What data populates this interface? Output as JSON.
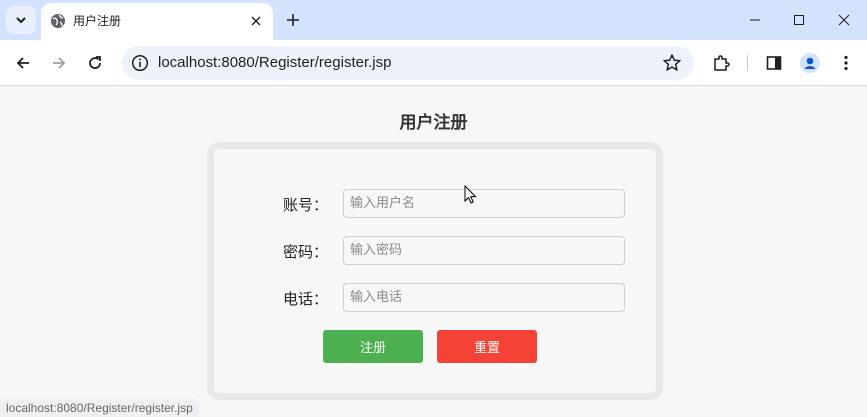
{
  "browser": {
    "tab_title": "用户注册",
    "url": "localhost:8080/Register/register.jsp",
    "status_url": "localhost:8080/Register/register.jsp"
  },
  "page": {
    "title": "用户注册",
    "fields": [
      {
        "label": "账号：",
        "placeholder": "输入用户名"
      },
      {
        "label": "密码：",
        "placeholder": "输入密码"
      },
      {
        "label": "电话：",
        "placeholder": "输入电话"
      }
    ],
    "buttons": {
      "register": {
        "label": "注册",
        "color": "#4caf50"
      },
      "reset": {
        "label": "重置",
        "color": "#f44336"
      }
    }
  },
  "colors": {
    "tabstrip": "#d3e3fd",
    "omnibox": "#edf2fa"
  }
}
